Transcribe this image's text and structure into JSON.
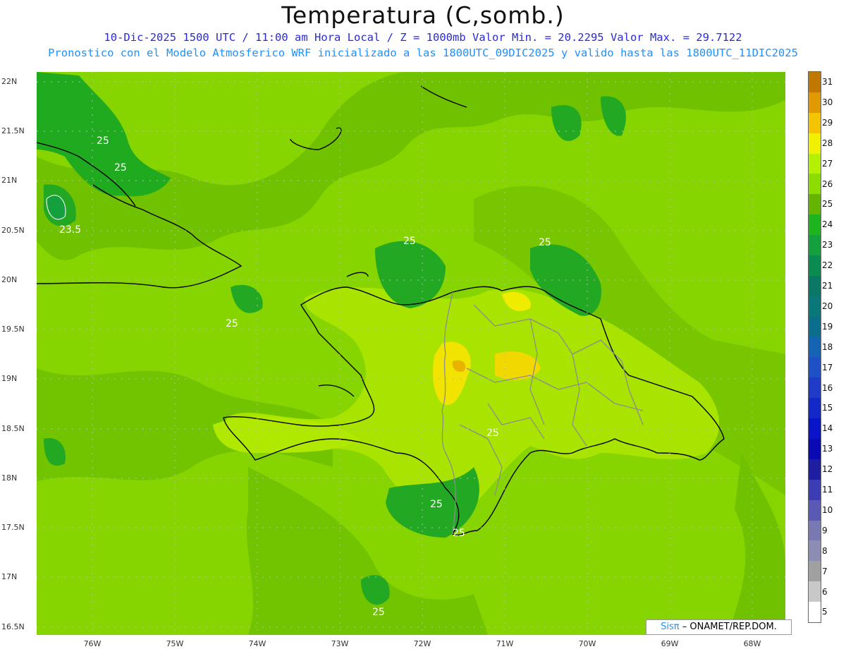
{
  "title": "Temperatura (C,somb.)",
  "subtitle1": "10-Dic-2025 1500 UTC / 11:00 am Hora Local / Z = 1000mb  Valor Min. = 20.2295  Valor Max. = 29.7122",
  "subtitle2": "Pronostico con el Modelo Atmosferico WRF inicializado a las 1800UTC_09DIC2025 y valido hasta las  1800UTC_11DIC2025",
  "lat_labels": [
    "22N",
    "21.5N",
    "21N",
    "20.5N",
    "20N",
    "19.5N",
    "19N",
    "18.5N",
    "18N",
    "17.5N",
    "17N",
    "16.5N"
  ],
  "lon_labels": [
    "76W",
    "75W",
    "74W",
    "73W",
    "72W",
    "71W",
    "70W",
    "69W",
    "68W"
  ],
  "colorbar": {
    "labels": [
      "31",
      "30",
      "29",
      "28",
      "27",
      "26",
      "25",
      "24",
      "23",
      "22",
      "21",
      "20",
      "19",
      "18",
      "17",
      "16",
      "15",
      "14",
      "13",
      "12",
      "11",
      "10",
      "9",
      "8",
      "7",
      "6",
      "5"
    ],
    "colors": [
      "#c07800",
      "#e09a00",
      "#f5c400",
      "#f0f000",
      "#b4f000",
      "#8cdc00",
      "#64b400",
      "#1eb41e",
      "#14a03c",
      "#0a8c50",
      "#0a7864",
      "#0a7878",
      "#0a6e8c",
      "#1464b4",
      "#1e50c8",
      "#1e3cc8",
      "#1428c8",
      "#0a14c8",
      "#0a0ab4",
      "#1e1ea0",
      "#3c3cb4",
      "#5a5ab4",
      "#7878b4",
      "#8c8cb4",
      "#a0a0a0",
      "#c8c8c8",
      "#ffffff"
    ]
  },
  "contour_labels": [
    "25",
    "25",
    "23.5",
    "25",
    "25",
    "25",
    "25",
    "25",
    "25",
    "25"
  ],
  "credit": {
    "brand": "Sisπ",
    "rest": "– ONAMET/REP.DOM."
  },
  "colors": {
    "base_field": "#86d400",
    "band_dark": "#6cbe00",
    "band_light": "#a8e600",
    "warm": "#f0e800",
    "hot": "#e9b400",
    "cool": "#22a822",
    "coast": "#000000",
    "border": "#8c8c8c"
  }
}
